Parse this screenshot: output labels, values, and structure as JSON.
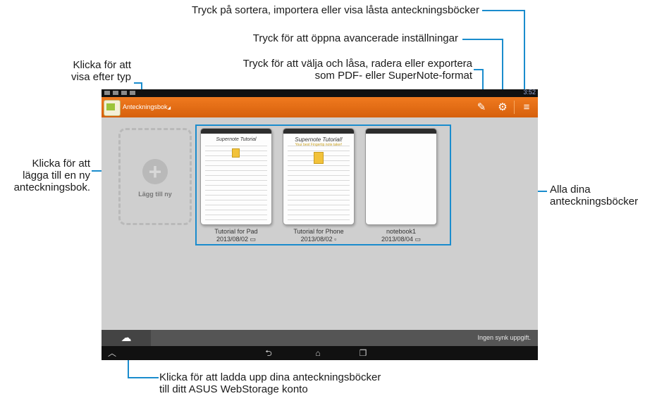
{
  "callouts": {
    "sort_import": "Tryck på sortera, importera eller visa låsta anteckningsböcker",
    "advanced_settings": "Tryck för att öppna avancerade inställningar",
    "select_lock_line1": "Tryck för att välja och låsa, radera eller exportera",
    "select_lock_line2": "som PDF- eller SuperNote-format",
    "view_by_type_line1": "Klicka för att",
    "view_by_type_line2": "visa efter typ",
    "add_new_line1": "Klicka för att",
    "add_new_line2": "lägga till en ny",
    "add_new_line3": "anteckningsbok.",
    "all_notebooks_line1": "Alla dina",
    "all_notebooks_line2": "anteckningsböcker",
    "upload_line1": "Klicka för att ladda upp dina anteckningsböcker",
    "upload_line2": "till ditt ASUS WebStorage konto"
  },
  "status_bar": {
    "time": "3:52"
  },
  "action_bar": {
    "type_dropdown_label": "Anteckningsbok",
    "icons": [
      "edit-select-icon",
      "gear-icon",
      "menu-icon"
    ]
  },
  "add_new": {
    "label": "Lägg till ny"
  },
  "notebooks": [
    {
      "name": "Tutorial for Pad",
      "date": "2013/08/02",
      "cover_title": "Supernote Tutorial"
    },
    {
      "name": "Tutorial for Phone",
      "date": "2013/08/02",
      "cover_title": "Supernote Tutorial!",
      "cover_subtitle": "Your best Fingertip note taker!"
    },
    {
      "name": "notebook1",
      "date": "2013/08/04"
    }
  ],
  "bottom_bar": {
    "sync_status": "Ingen synk uppgift."
  },
  "colors": {
    "accent": "#1a8ccd",
    "action_bar": "#e86e15"
  }
}
